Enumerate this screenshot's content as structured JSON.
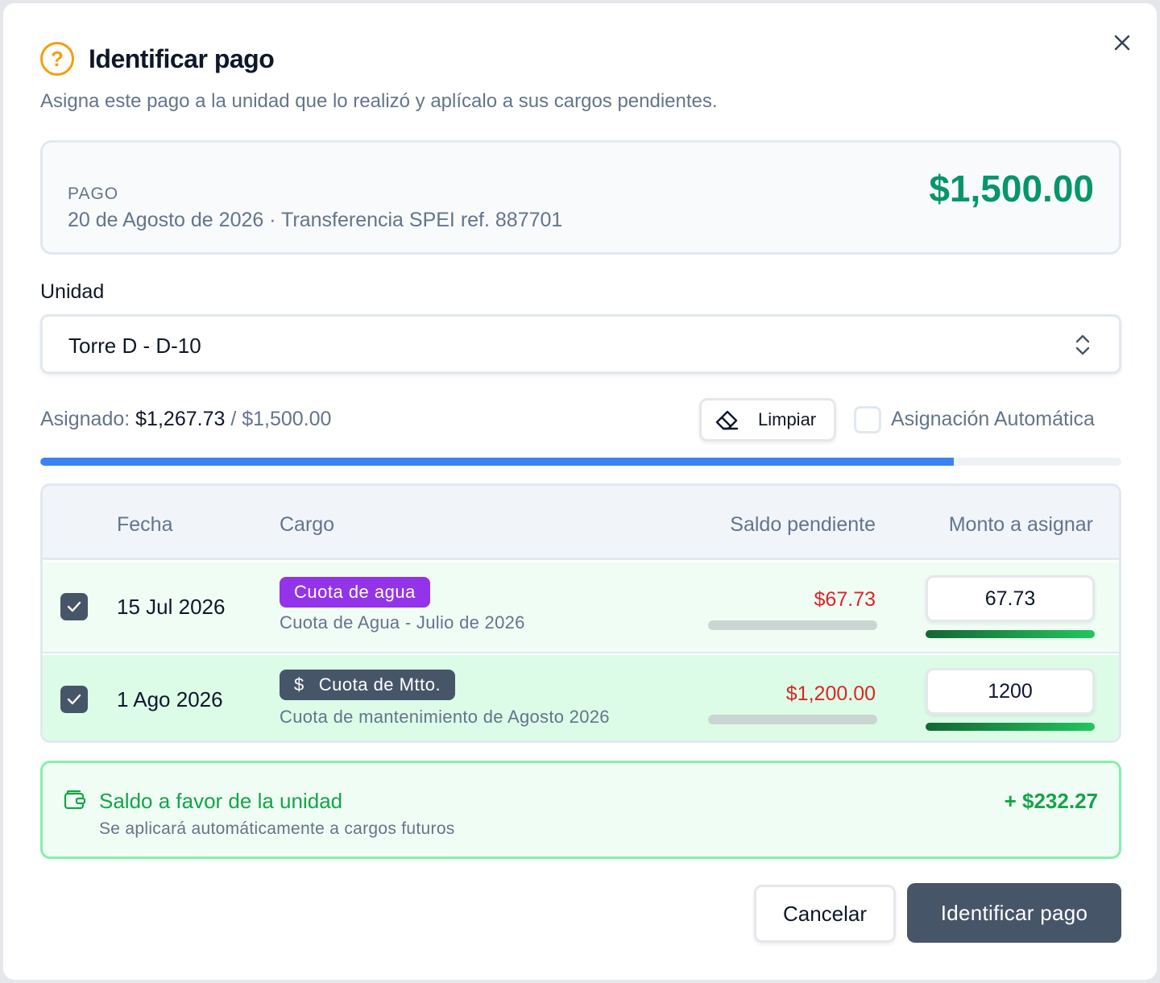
{
  "dialog": {
    "title": "Identificar pago",
    "subtitle": "Asigna este pago a la unidad que lo realizó y aplícalo a sus cargos pendientes."
  },
  "payment": {
    "label": "PAGO",
    "description": "20 de Agosto de 2026 · Transferencia SPEI ref. 887701",
    "amount": "$1,500.00"
  },
  "unit": {
    "label": "Unidad",
    "selected": "Torre D - D-10"
  },
  "assignment": {
    "label": "Asignado:",
    "assigned": "$1,267.73",
    "separator": "/",
    "total": "$1,500.00",
    "progress_fraction": 0.8452,
    "clear_label": "Limpiar",
    "auto_label": "Asignación Automática",
    "auto_checked": false
  },
  "table": {
    "headers": {
      "date": "Fecha",
      "charge": "Cargo",
      "balance": "Saldo pendiente",
      "amount": "Monto a asignar"
    },
    "rows": [
      {
        "checked": true,
        "date": "15 Jul 2026",
        "tag": "Cuota de agua",
        "description": "Cuota de Agua - Julio de 2026",
        "balance": "$67.73",
        "amount": "67.73"
      },
      {
        "checked": true,
        "date": "1 Ago 2026",
        "tag_icon": "$",
        "tag": "Cuota de Mtto.",
        "description": "Cuota de mantenimiento de Agosto 2026",
        "balance": "$1,200.00",
        "amount": "1200"
      }
    ]
  },
  "credit": {
    "title": "Saldo a favor de la unidad",
    "subtitle": "Se aplicará automáticamente a cargos futuros",
    "amount": "+ $232.27"
  },
  "actions": {
    "cancel": "Cancelar",
    "submit": "Identificar pago"
  },
  "colors": {
    "accent_green": "#059669",
    "progress_blue": "#3b82f6",
    "danger_red": "#dc2626",
    "tag_purple": "#9333ea",
    "tag_slate": "#475569",
    "warning_amber": "#f59e0b"
  }
}
